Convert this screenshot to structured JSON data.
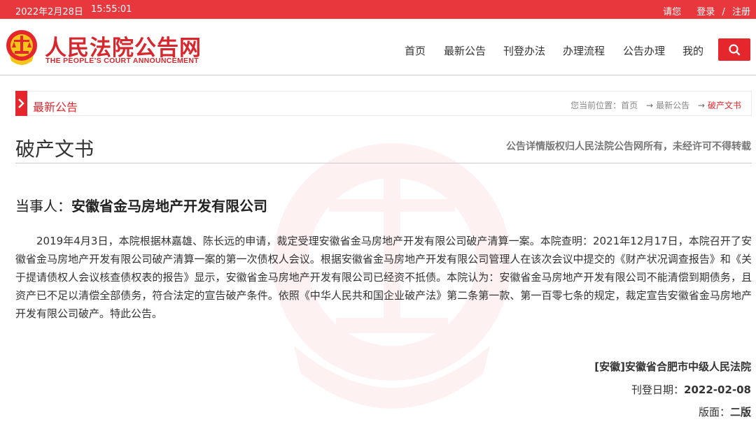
{
  "topbar": {
    "date": "2022年2月28日",
    "time": "15:55:01",
    "login_prompt": "请您",
    "login_label": "登录",
    "separator": "/",
    "register_label": "注册"
  },
  "logo": {
    "title": "人民法院公告网",
    "subtitle": "THE PEOPLE’S COURT ANNOUNCEMENT"
  },
  "nav": {
    "items": [
      "首页",
      "最新公告",
      "刊登办法",
      "办理流程",
      "公告办理",
      "我的"
    ]
  },
  "icons": {
    "search": "search-icon",
    "section_marker": "chevron-right-icon",
    "emblem": "court-emblem-icon"
  },
  "colors": {
    "brand_red": "#e5262c",
    "topbar_red": "#e8383d"
  },
  "section": {
    "title": "最新公告"
  },
  "breadcrumb": {
    "prefix": "您当前位置：",
    "home": "首页",
    "arrow": "→",
    "level1": "最新公告",
    "current": "破产文书"
  },
  "document": {
    "type": "破产文书",
    "copyright_notice": "公告详情版权归人民法院公告网所有，未经许可不得转载",
    "party_label": "当事人：",
    "party_name": "安徽省金马房地产开发有限公司",
    "body": "2019年4月3日，本院根据林嘉雄、陈长远的申请，裁定受理安徽省金马房地产开发有限公司破产清算一案。本院查明：2021年12月17日，本院召开了安徽省金马房地产开发有限公司破产清算一案的第一次债权人会议。根据安徽省金马房地产开发有限公司管理人在该次会议中提交的《财产状况调查报告》和《关于提请债权人会议核查债权表的报告》显示，安徽省金马房地产开发有限公司已经资不抵债。本院认为：安徽省金马房地产开发有限公司不能清偿到期债务，且资产已不足以清偿全部债务，符合法定的宣告破产条件。依照《中华人民共和国企业破产法》第二条第一款、第一百零七条的规定，裁定宣告安徽省金马房地产开发有限公司破产。特此公告。",
    "court": "[安徽]安徽省合肥市中级人民法院",
    "pubdate_label": "刊登日期：",
    "pubdate": "2022-02-08",
    "edition_label": "版面：",
    "edition": "二版"
  }
}
